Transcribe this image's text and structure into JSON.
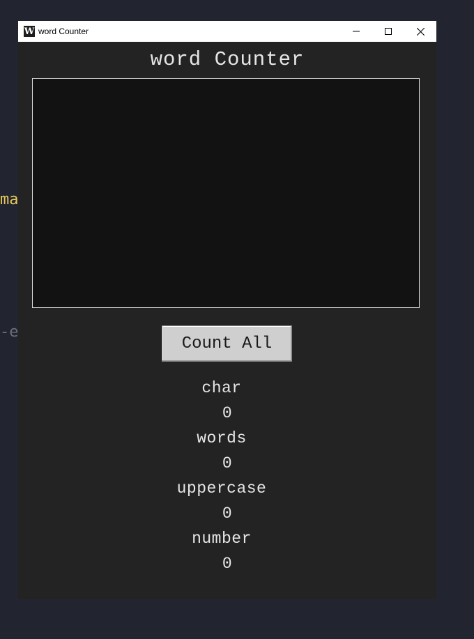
{
  "background": {
    "fragment_top": "ma",
    "fragment_bottom": "-e"
  },
  "window": {
    "title": "word Counter",
    "icon_letter": "W",
    "controls": [
      "minimize-icon",
      "maximize-icon",
      "close-icon"
    ]
  },
  "app": {
    "heading": "word Counter",
    "textarea_value": "",
    "button_label": "Count All",
    "stats": [
      {
        "label": "char",
        "value": "0"
      },
      {
        "label": "words",
        "value": "0"
      },
      {
        "label": "uppercase",
        "value": "0"
      },
      {
        "label": "number",
        "value": "0"
      }
    ]
  },
  "colors": {
    "desktop": "#22252f",
    "window_bg": "#232323",
    "textarea_bg": "#121212",
    "button_bg": "#cfcfcf",
    "text": "#e6e6e6",
    "accent_yellow": "#e8c85a"
  }
}
